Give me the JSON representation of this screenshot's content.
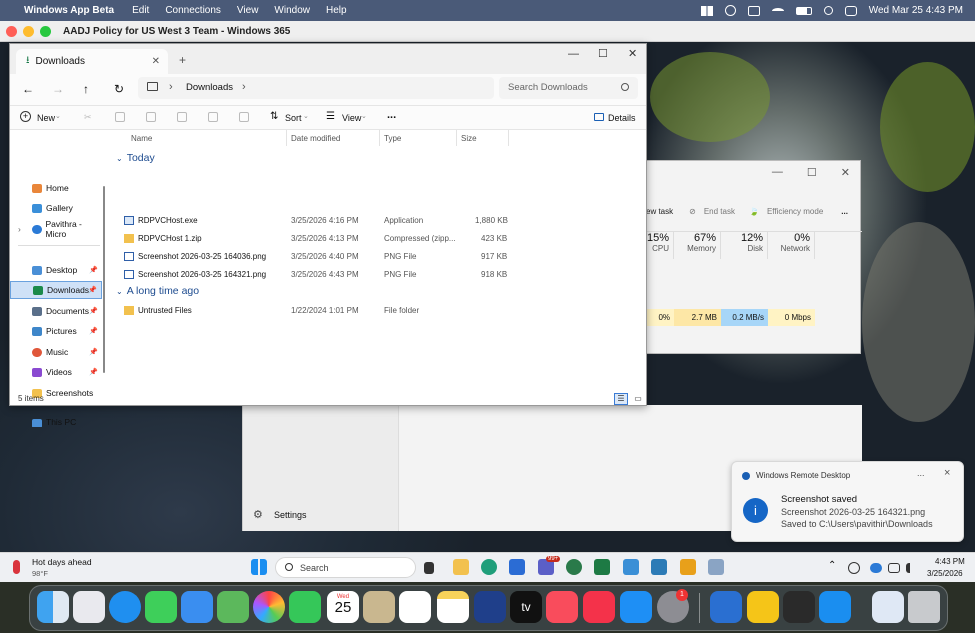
{
  "menubar": {
    "app": "Windows App Beta",
    "items": [
      "Edit",
      "Connections",
      "View",
      "Window",
      "Help"
    ],
    "datetime": "Wed Mar 25  4:43 PM"
  },
  "rdp": {
    "title": "AADJ Policy for US West 3 Team - Windows 365"
  },
  "explorer": {
    "tab": "Downloads",
    "breadcrumb": "Downloads",
    "search_placeholder": "Search Downloads",
    "cmd": {
      "new": "New",
      "sort": "Sort",
      "view": "View",
      "more": "...",
      "details": "Details"
    },
    "nav": [
      {
        "label": "Home",
        "icon": "home-icon"
      },
      {
        "label": "Gallery",
        "icon": "gallery-icon"
      },
      {
        "label": "Pavithra - Micro",
        "icon": "cloud-icon"
      },
      {
        "label": "Desktop",
        "icon": "desktop-icon"
      },
      {
        "label": "Downloads",
        "icon": "download-icon"
      },
      {
        "label": "Documents",
        "icon": "documents-icon"
      },
      {
        "label": "Pictures",
        "icon": "pictures-icon"
      },
      {
        "label": "Music",
        "icon": "music-icon"
      },
      {
        "label": "Videos",
        "icon": "videos-icon"
      },
      {
        "label": "Screenshots",
        "icon": "folder-icon"
      },
      {
        "label": "This PC",
        "icon": "pc-icon"
      }
    ],
    "columns": [
      "Name",
      "Date modified",
      "Type",
      "Size"
    ],
    "groups": [
      {
        "label": "Today",
        "files": [
          {
            "name": "RDPVCHost.exe",
            "date": "3/25/2026 4:16 PM",
            "type": "Application",
            "size": "1,880 KB"
          },
          {
            "name": "RDPVCHost 1.zip",
            "date": "3/25/2026 4:13 PM",
            "type": "Compressed (zipp...",
            "size": "423 KB"
          },
          {
            "name": "Screenshot 2026-03-25 164036.png",
            "date": "3/25/2026 4:40 PM",
            "type": "PNG File",
            "size": "917 KB"
          },
          {
            "name": "Screenshot 2026-03-25 164321.png",
            "date": "3/25/2026 4:43 PM",
            "type": "PNG File",
            "size": "918 KB"
          }
        ]
      },
      {
        "label": "A long time ago",
        "files": [
          {
            "name": "Untrusted Files",
            "date": "1/22/2024 1:01 PM",
            "type": "File folder",
            "size": ""
          }
        ]
      }
    ],
    "status": "5 items"
  },
  "taskmgr": {
    "tools": {
      "new_task": "ew task",
      "end_task": "End task",
      "efficiency": "Efficiency mode",
      "more": "..."
    },
    "cols": [
      {
        "pct": "15%",
        "label": "CPU"
      },
      {
        "pct": "67%",
        "label": "Memory"
      },
      {
        "pct": "12%",
        "label": "Disk"
      },
      {
        "pct": "0%",
        "label": "Network"
      }
    ],
    "row": [
      "0%",
      "2.7 MB",
      "0.2 MB/s",
      "0 Mbps"
    ]
  },
  "settings": {
    "label": "Settings"
  },
  "notification": {
    "app": "Windows Remote Desktop",
    "title": "Screenshot saved",
    "file": "Screenshot 2026-03-25 164321.png",
    "path": "Saved to C:\\Users\\pavithir\\Downloads",
    "more": "...",
    "close": "×"
  },
  "taskbar": {
    "weather_title": "Hot days ahead",
    "weather_temp": "98°F",
    "search": "Search",
    "time": "4:43 PM",
    "date": "3/25/2026",
    "badge": "99+"
  },
  "dock": {
    "calendar_month": "Wed",
    "calendar_day": "25",
    "settings_badge": "1",
    "tv": "tv"
  }
}
